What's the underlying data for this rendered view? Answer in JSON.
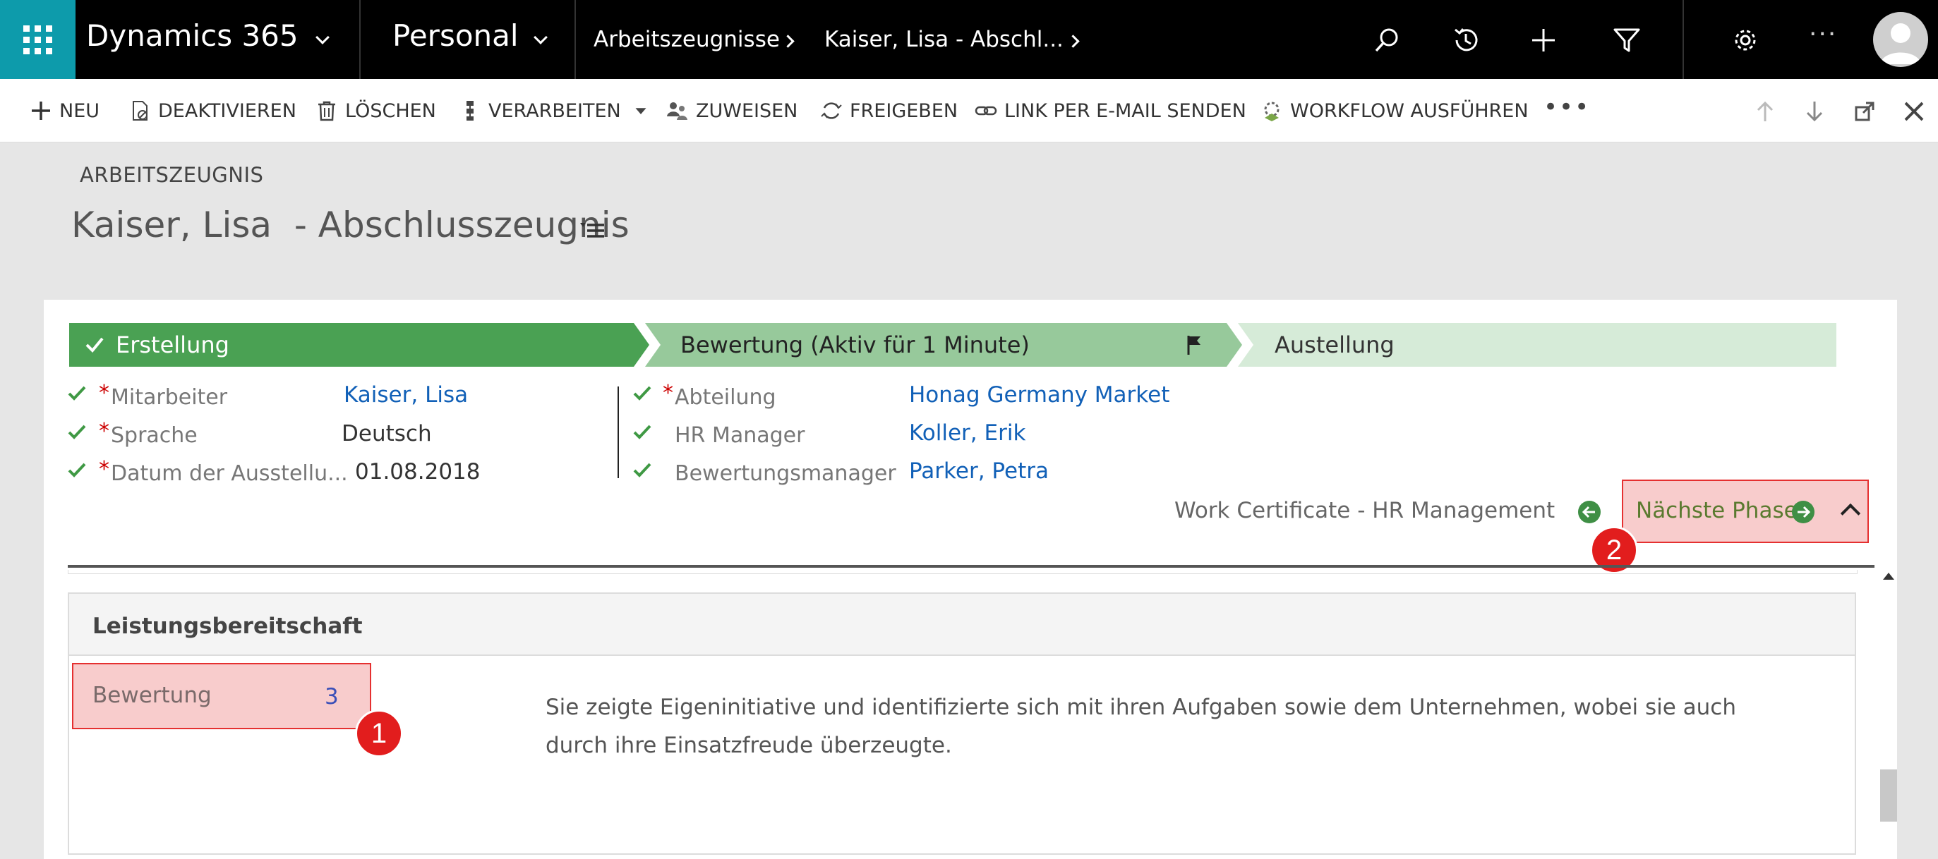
{
  "topnav": {
    "app_name": "Dynamics 365",
    "area": "Personal",
    "breadcrumbs": [
      "Arbeitszeugnisse",
      "Kaiser, Lisa  - Abschl..."
    ],
    "more": "···",
    "icons": [
      "search-icon",
      "recent-icon",
      "add-icon",
      "filter-icon",
      "settings-icon",
      "more-icon",
      "avatar"
    ]
  },
  "commandbar": {
    "new": "NEU",
    "deactivate": "DEAKTIVIEREN",
    "delete": "LÖSCHEN",
    "process": "VERARBEITEN",
    "assign": "ZUWEISEN",
    "share": "FREIGEBEN",
    "email_link": "LINK PER E-MAIL SENDEN",
    "run_workflow": "WORKFLOW AUSFÜHREN",
    "more": "•••"
  },
  "header": {
    "entity": "ARBEITSZEUGNIS",
    "title": "Kaiser, Lisa  - Abschlusszeugnis"
  },
  "bpf": {
    "stages": [
      {
        "label": "Erstellung",
        "state": "completed"
      },
      {
        "label": "Bewertung (Aktiv für 1 Minute)",
        "state": "active"
      },
      {
        "label": "Austellung",
        "state": "upcoming"
      }
    ],
    "fields_left": [
      {
        "label": "Mitarbeiter",
        "value": "Kaiser, Lisa",
        "required": true,
        "link": true
      },
      {
        "label": "Sprache",
        "value": "Deutsch",
        "required": true,
        "link": false
      },
      {
        "label": "Datum der Ausstellu...",
        "value": "01.08.2018",
        "required": true,
        "link": false
      }
    ],
    "fields_right": [
      {
        "label": "Abteilung",
        "value": "Honag Germany Market",
        "required": true,
        "link": true
      },
      {
        "label": "HR Manager",
        "value": "Koller, Erik",
        "required": false,
        "link": true
      },
      {
        "label": "Bewertungsmanager",
        "value": "Parker, Petra",
        "required": false,
        "link": true
      }
    ],
    "process_name": "Work Certificate - HR Management",
    "next_phase": "Nächste Phase"
  },
  "markers": {
    "one": "1",
    "two": "2"
  },
  "section": {
    "title": "Leistungsbereitschaft",
    "rating_label": "Bewertung",
    "rating_value": "3",
    "text": "Sie zeigte Eigeninitiative und identifizierte sich mit ihren Aufgaben sowie dem Unternehmen, wobei sie auch durch ihre Einsatzfreude überzeugte."
  },
  "colors": {
    "waffle": "#0d9bab",
    "stage_done": "#4aa153",
    "stage_active": "#97c99b",
    "stage_next": "#d6ebd8",
    "link": "#1160b7",
    "highlight": "#f8cccc",
    "marker": "#e21d1d"
  }
}
